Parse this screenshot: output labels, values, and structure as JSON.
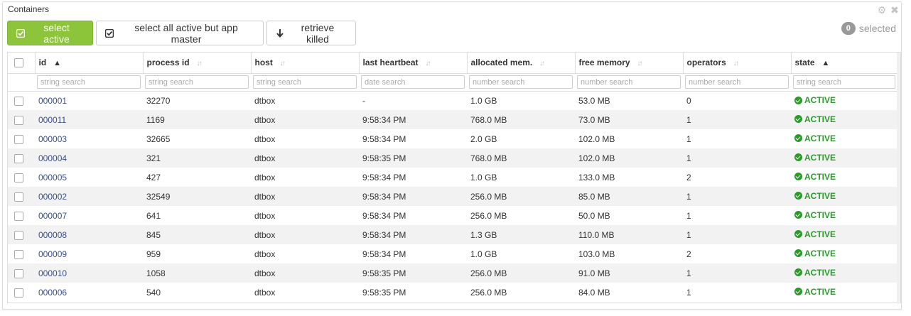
{
  "panel": {
    "title": "Containers"
  },
  "toolbar": {
    "select_active": "select active",
    "select_all_but_master": "select all active but app master",
    "retrieve_killed": "retrieve killed"
  },
  "selection": {
    "count": "0",
    "label": "selected"
  },
  "table": {
    "columns": [
      {
        "key": "id",
        "label": "id",
        "filter": "string search",
        "sort": "asc"
      },
      {
        "key": "pid",
        "label": "process id",
        "filter": "string search",
        "sort": "none"
      },
      {
        "key": "host",
        "label": "host",
        "filter": "string search",
        "sort": "none"
      },
      {
        "key": "hb",
        "label": "last heartbeat",
        "filter": "date search",
        "sort": "none"
      },
      {
        "key": "mem",
        "label": "allocated mem.",
        "filter": "number search",
        "sort": "none"
      },
      {
        "key": "free",
        "label": "free memory",
        "filter": "number search",
        "sort": "none"
      },
      {
        "key": "ops",
        "label": "operators",
        "filter": "number search",
        "sort": "none"
      },
      {
        "key": "state",
        "label": "state",
        "filter": "string search",
        "sort": "asc"
      }
    ],
    "rows": [
      {
        "id": "000001",
        "pid": "32270",
        "host": "dtbox",
        "hb": "-",
        "mem": "1.0 GB",
        "free": "53.0 MB",
        "ops": "0",
        "state": "ACTIVE"
      },
      {
        "id": "000011",
        "pid": "1169",
        "host": "dtbox",
        "hb": "9:58:34 PM",
        "mem": "768.0 MB",
        "free": "73.0 MB",
        "ops": "1",
        "state": "ACTIVE"
      },
      {
        "id": "000003",
        "pid": "32665",
        "host": "dtbox",
        "hb": "9:58:34 PM",
        "mem": "2.0 GB",
        "free": "102.0 MB",
        "ops": "1",
        "state": "ACTIVE"
      },
      {
        "id": "000004",
        "pid": "321",
        "host": "dtbox",
        "hb": "9:58:35 PM",
        "mem": "768.0 MB",
        "free": "102.0 MB",
        "ops": "1",
        "state": "ACTIVE"
      },
      {
        "id": "000005",
        "pid": "427",
        "host": "dtbox",
        "hb": "9:58:34 PM",
        "mem": "1.0 GB",
        "free": "133.0 MB",
        "ops": "2",
        "state": "ACTIVE"
      },
      {
        "id": "000002",
        "pid": "32549",
        "host": "dtbox",
        "hb": "9:58:34 PM",
        "mem": "256.0 MB",
        "free": "85.0 MB",
        "ops": "1",
        "state": "ACTIVE"
      },
      {
        "id": "000007",
        "pid": "641",
        "host": "dtbox",
        "hb": "9:58:34 PM",
        "mem": "256.0 MB",
        "free": "50.0 MB",
        "ops": "1",
        "state": "ACTIVE"
      },
      {
        "id": "000008",
        "pid": "845",
        "host": "dtbox",
        "hb": "9:58:34 PM",
        "mem": "1.3 GB",
        "free": "110.0 MB",
        "ops": "1",
        "state": "ACTIVE"
      },
      {
        "id": "000009",
        "pid": "959",
        "host": "dtbox",
        "hb": "9:58:34 PM",
        "mem": "1.0 GB",
        "free": "103.0 MB",
        "ops": "2",
        "state": "ACTIVE"
      },
      {
        "id": "000010",
        "pid": "1058",
        "host": "dtbox",
        "hb": "9:58:35 PM",
        "mem": "256.0 MB",
        "free": "91.0 MB",
        "ops": "1",
        "state": "ACTIVE"
      },
      {
        "id": "000006",
        "pid": "540",
        "host": "dtbox",
        "hb": "9:58:35 PM",
        "mem": "256.0 MB",
        "free": "84.0 MB",
        "ops": "1",
        "state": "ACTIVE"
      }
    ]
  }
}
